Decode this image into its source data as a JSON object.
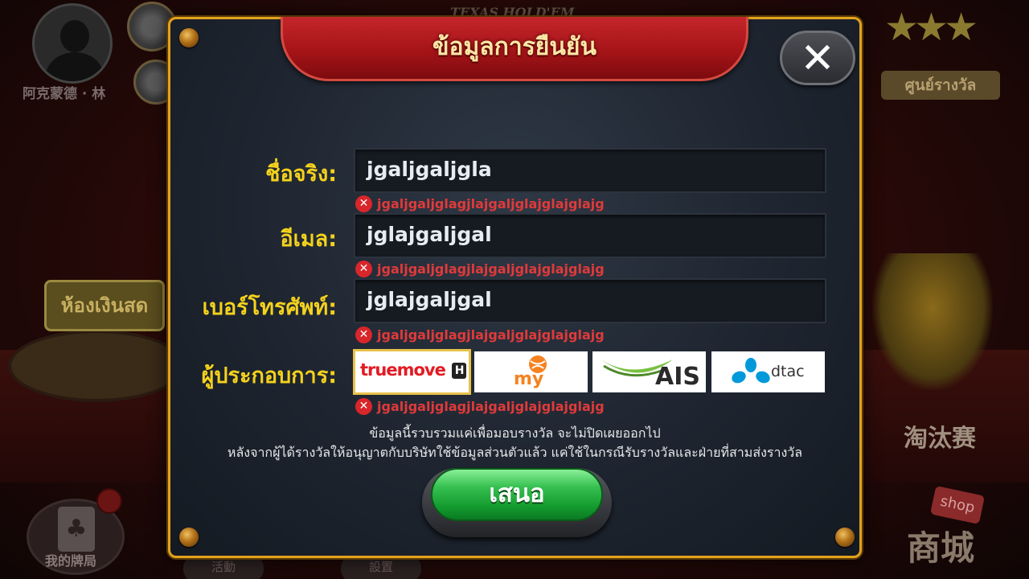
{
  "background": {
    "game_title": "TEXAS HOLD'EM",
    "player_name": "阿克蒙德 · 林",
    "reward_center": "ศูนย์รางวัล",
    "cash_room": "ห้องเงินสด",
    "tournament": "淘汰赛",
    "shop_label": "商城",
    "shop_tag": "shop",
    "my_hands": "我的牌局",
    "activity": "活動",
    "settings": "設置"
  },
  "dialog": {
    "title": "ข้อมูลการยืนยัน",
    "close_icon": "close-x-icon",
    "fields": {
      "real_name_label": "ชื่อจริง:",
      "real_name_value": "jgaljgaljgla",
      "real_name_error": "jgaljgaljglagjlajgaljglajglajglajg",
      "email_label": "อีเมล:",
      "email_value": "jglajgaljgal",
      "email_error": "jgaljgaljglagjlajgaljglajglajglajg",
      "phone_label": "เบอร์โทรศัพท์:",
      "phone_value": "jglajgaljgal",
      "phone_error": "jgaljgaljglagjlajgaljglajglajglajg",
      "carrier_label": "ผู้ประกอบการ:",
      "carrier_error": "jgaljgaljglagjlajgaljglajglajglajg"
    },
    "carriers": {
      "truemove": "truemove",
      "truemove_badge": "H",
      "my": "my",
      "ais": "AIS",
      "dtac": "dtac"
    },
    "notice_line1": "ข้อมูลนี้รวบรวมแค่เพื่อมอบรางวัล  จะไม่ปิดเผยออกไป",
    "notice_line2": "หลังจากผู้ได้รางวัลให้อนุญาตกับบริษัทใช้ข้อมูลส่วนตัวแล้ว  แค่ใช้ในกรณีรับรางวัลและฝ่ายที่สามส่งรางวัล",
    "submit_label": "เสนอ"
  },
  "colors": {
    "dialog_border": "#e2a21c",
    "label_yellow": "#f5d21c",
    "error_red": "#e03a3a",
    "submit_green": "#139a2e",
    "title_banner_red": "#a61418"
  }
}
